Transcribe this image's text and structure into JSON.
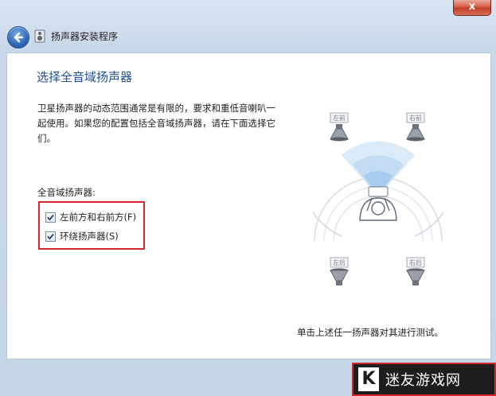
{
  "window": {
    "close_label": "x"
  },
  "nav": {
    "title": "扬声器安装程序"
  },
  "main": {
    "heading": "选择全音域扬声器",
    "description": "卫星扬声器的动态范围通常是有限的，要求和重低音喇叭一起使用。如果您的配置包括全音域扬声器，请在下面选择它们。",
    "group_label": "全音域扬声器:",
    "checkboxes": [
      {
        "label": "左前方和右前方(F)",
        "checked": true
      },
      {
        "label": "环绕扬声器(S)",
        "checked": true
      }
    ],
    "diagram": {
      "front_left": "左前",
      "front_right": "右前",
      "rear_left": "左后",
      "rear_right": "右后"
    },
    "footer_note": "单击上述任一扬声器对其进行测试。"
  },
  "watermark": {
    "letter": "K",
    "text": "迷友游戏网"
  }
}
